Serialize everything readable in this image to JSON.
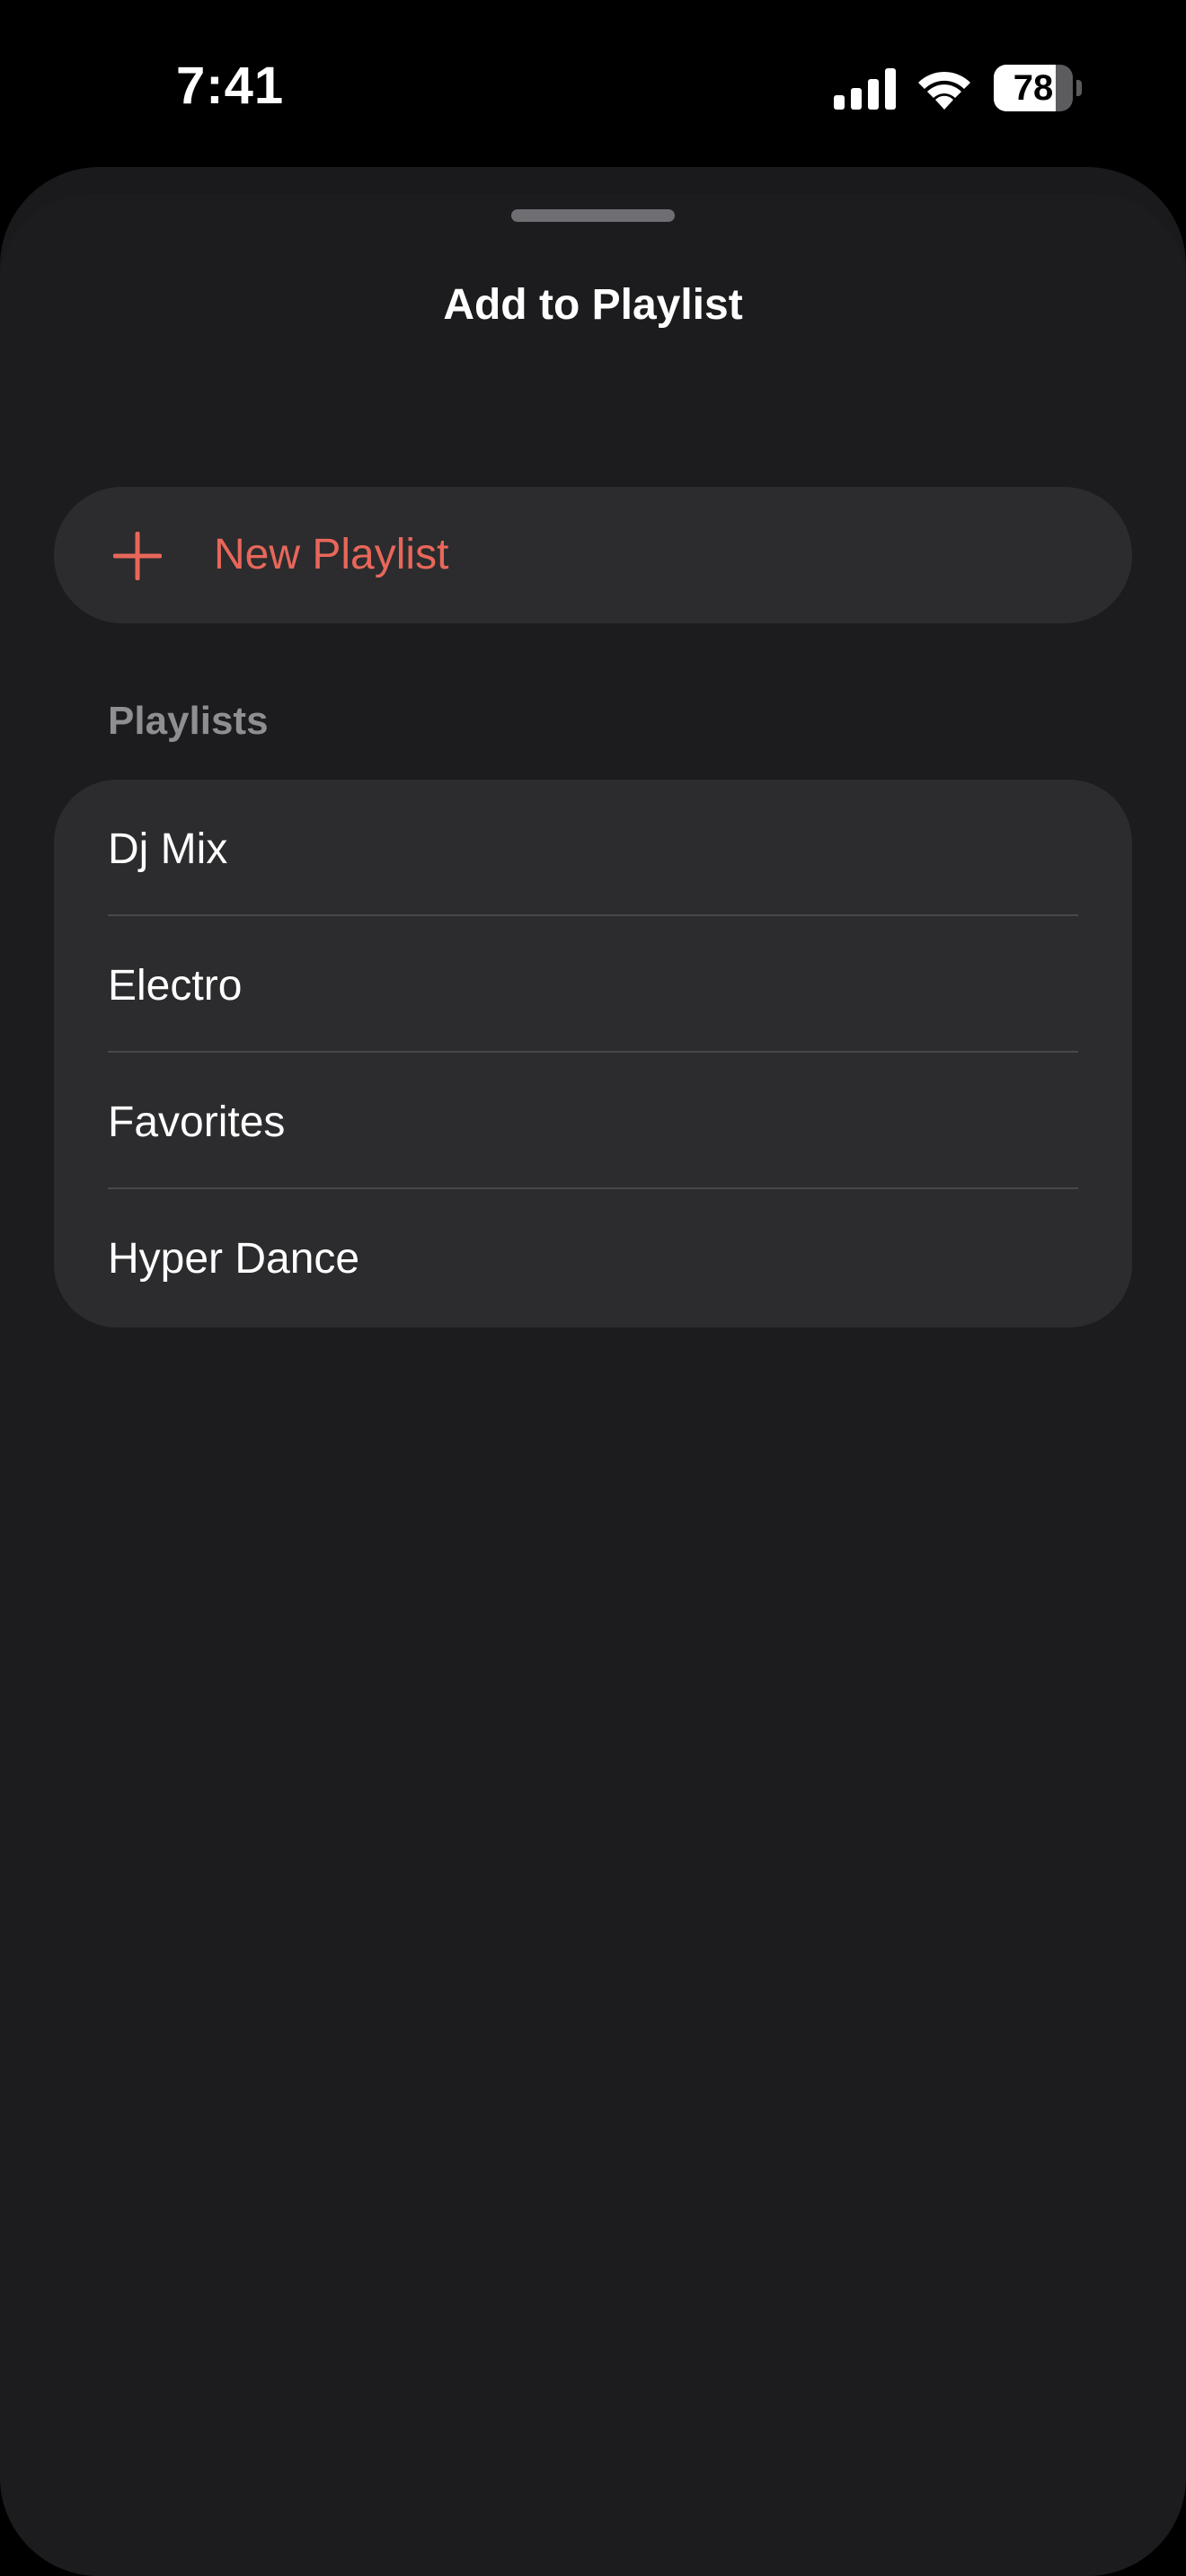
{
  "status_bar": {
    "time": "7:41",
    "battery_level": "78",
    "battery_fraction": 0.78
  },
  "sheet": {
    "title": "Add to Playlist"
  },
  "new_playlist": {
    "label": "New Playlist",
    "icon": "plus-icon"
  },
  "playlists": {
    "header": "Playlists",
    "items": [
      {
        "label": "Dj Mix"
      },
      {
        "label": "Electro"
      },
      {
        "label": "Favorites"
      },
      {
        "label": "Hyper Dance"
      }
    ]
  },
  "colors": {
    "accent": "#e8675a",
    "background": "#1c1c1e",
    "card": "#2c2c2e",
    "secondary_text": "#8e8e93"
  }
}
